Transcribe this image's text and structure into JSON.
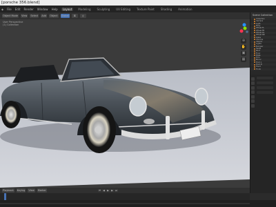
{
  "window": {
    "title": "[porsche 356.blend]"
  },
  "menubar": {
    "items": [
      "File",
      "Edit",
      "Render",
      "Window",
      "Help"
    ],
    "workspaces": [
      "Layout",
      "Modeling",
      "Sculpting",
      "UV Editing",
      "Texture Paint",
      "Shading",
      "Animation",
      "Rendering",
      "Compositing",
      "Scripting"
    ],
    "active_workspace": "Layout"
  },
  "viewport": {
    "header_buttons": [
      "Object Mode",
      "View",
      "Select",
      "Add",
      "Object",
      "Global"
    ],
    "info": [
      "User Perspective",
      "(1) Collection"
    ]
  },
  "outliner": {
    "header": "Scene Collection",
    "rows": [
      "Collection",
      "Camera",
      "Light",
      "Body",
      "Wheel.FL",
      "Wheel.FR",
      "Wheel.RL",
      "Wheel.RR",
      "Glass",
      "Chrome",
      "Interior",
      "Lights",
      "Bumper",
      "Seats",
      "Roof",
      "Floor",
      "Plate",
      "Trim",
      "Mirror",
      "Door.L",
      "Door.R",
      "Hood",
      "Trunk"
    ]
  },
  "timeline": {
    "labels": [
      "Playback",
      "Keying",
      "View",
      "Marker"
    ]
  },
  "colors": {
    "accent": "#4772b3",
    "car_body": "#4a5158",
    "background": "#3b3b3b",
    "floor": "#c9ccd3"
  }
}
